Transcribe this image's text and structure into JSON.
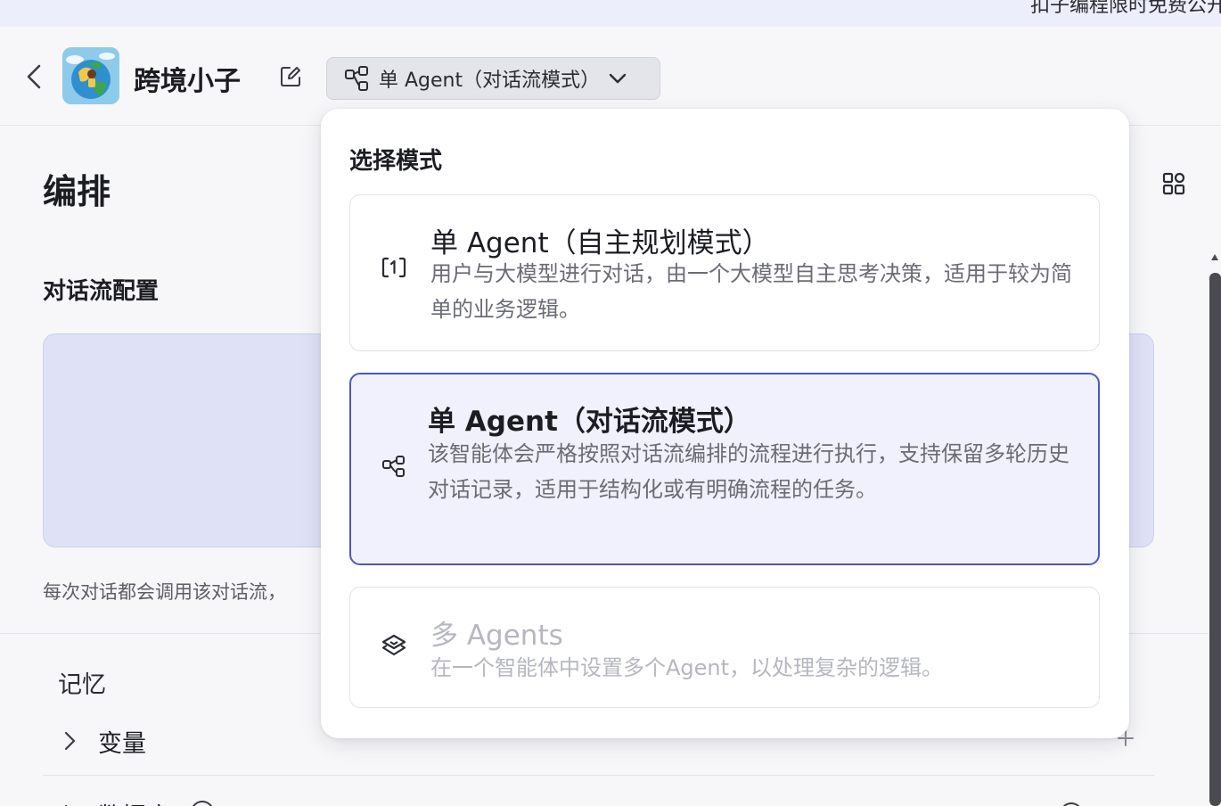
{
  "banner": {
    "text": "扣子编程限时免费公开"
  },
  "header": {
    "app_name": "跨境小子",
    "mode_label": "单 Agent（对话流模式）"
  },
  "main": {
    "section_title": "编排",
    "flow_config_title": "对话流配置",
    "flow_desc": "每次对话都会调用该对话流，",
    "memory_title": "记忆",
    "variables_label": "变量",
    "database_label": "数据库"
  },
  "dropdown": {
    "title": "选择模式",
    "options": [
      {
        "title": "单 Agent（自主规划模式）",
        "desc": "用户与大模型进行对话，由一个大模型自主思考决策，适用于较为简单的业务逻辑。",
        "icon": "single-agent-icon",
        "state": "default"
      },
      {
        "title": "单 Agent（对话流模式）",
        "desc": "该智能体会严格按照对话流编排的流程进行执行，支持保留多轮历史对话记录，适用于结构化或有明确流程的任务。",
        "icon": "workflow-icon",
        "state": "selected"
      },
      {
        "title": "多 Agents",
        "desc": "在一个智能体中设置多个Agent，以处理复杂的逻辑。",
        "icon": "layers-icon",
        "state": "disabled"
      }
    ]
  },
  "colors": {
    "accent": "#4f55c8",
    "selected_bg": "#f0f1fc",
    "flow_box_bg": "#dfe1f7",
    "banner_bg": "#eceefb"
  }
}
